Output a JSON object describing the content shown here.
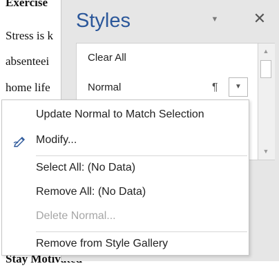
{
  "document": {
    "lines": [
      "Exercise",
      "Stress is k",
      "absenteei",
      "home life",
      "Stay Motivated"
    ]
  },
  "styles_pane": {
    "title": "Styles",
    "dropdown_icon": "chevron-down-icon",
    "close_icon": "close-icon",
    "items": [
      {
        "label": "Clear All"
      },
      {
        "label": "Normal",
        "paragraph_mark": "¶"
      }
    ]
  },
  "context_menu": {
    "items": [
      {
        "label": "Update Normal to Match Selection",
        "enabled": true
      },
      {
        "label": "Modify...",
        "enabled": true,
        "icon": "modify-pencil-icon"
      },
      {
        "label": "Select All: (No Data)",
        "enabled": true
      },
      {
        "label": "Remove All: (No Data)",
        "enabled": true
      },
      {
        "label": "Delete Normal...",
        "enabled": false
      },
      {
        "label": "Remove from Style Gallery",
        "enabled": true
      }
    ]
  },
  "colors": {
    "title_blue": "#2b579a",
    "disabled_text": "#a6a6a6"
  }
}
